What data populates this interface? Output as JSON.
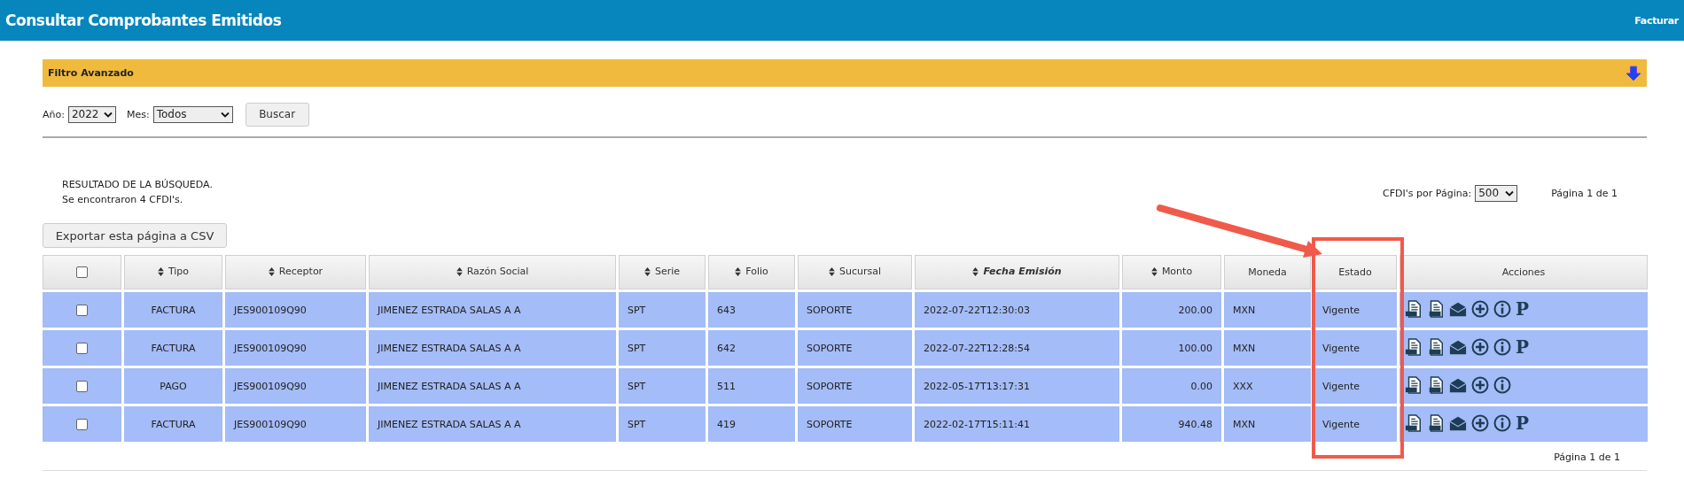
{
  "header": {
    "title": "Consultar Comprobantes Emitidos",
    "link": "Facturar"
  },
  "filter": {
    "title": "Filtro Avanzado",
    "expanded": false,
    "year_label": "Año:",
    "year": "2022",
    "month_label": "Mes:",
    "month": "Todos",
    "search_button": "Buscar"
  },
  "results": {
    "heading": "RESULTADO DE LA BÚSQUEDA.",
    "count": "Se encontraron 4 CFDI's.",
    "per_page_label": "CFDI's por Página:",
    "per_page": "500",
    "page_top": "Página 1 de 1",
    "export_button": "Exportar esta página a CSV",
    "page_bottom": "Página 1 de 1"
  },
  "table": {
    "select_all_checked": false,
    "columns": [
      {
        "label": "Tipo",
        "sortable": true,
        "sorted": false
      },
      {
        "label": "Receptor",
        "sortable": true,
        "sorted": false
      },
      {
        "label": "Razón Social",
        "sortable": true,
        "sorted": false
      },
      {
        "label": "Serie",
        "sortable": true,
        "sorted": false
      },
      {
        "label": "Folio",
        "sortable": true,
        "sorted": false
      },
      {
        "label": "Sucursal",
        "sortable": true,
        "sorted": false
      },
      {
        "label": "Fecha Emisión",
        "sortable": true,
        "sorted": true
      },
      {
        "label": "Monto",
        "sortable": true,
        "sorted": false
      },
      {
        "label": "Moneda",
        "sortable": false,
        "sorted": false
      },
      {
        "label": "Estado",
        "sortable": false,
        "sorted": false
      },
      {
        "label": "Acciones",
        "sortable": false,
        "sorted": false
      }
    ],
    "rows": [
      {
        "checked": false,
        "cells": [
          "FACTURA",
          "JES900109Q90",
          "JIMENEZ ESTRADA SALAS A A",
          "SPT",
          "643",
          "SOPORTE",
          "2022-07-22T12:30:03",
          "200.00",
          "MXN",
          "Vigente"
        ],
        "actions": [
          {
            "kind": "xml"
          },
          {
            "kind": "pdf"
          },
          {
            "kind": "mail"
          },
          {
            "kind": "add"
          },
          {
            "kind": "info"
          },
          {
            "kind": "letter",
            "label": "P"
          }
        ]
      },
      {
        "checked": false,
        "cells": [
          "FACTURA",
          "JES900109Q90",
          "JIMENEZ ESTRADA SALAS A A",
          "SPT",
          "642",
          "SOPORTE",
          "2022-07-22T12:28:54",
          "100.00",
          "MXN",
          "Vigente"
        ],
        "actions": [
          {
            "kind": "xml"
          },
          {
            "kind": "pdf"
          },
          {
            "kind": "mail"
          },
          {
            "kind": "add"
          },
          {
            "kind": "info"
          },
          {
            "kind": "letter",
            "label": "P"
          }
        ]
      },
      {
        "checked": false,
        "cells": [
          "PAGO",
          "JES900109Q90",
          "JIMENEZ ESTRADA SALAS A A",
          "SPT",
          "511",
          "SOPORTE",
          "2022-05-17T13:17:31",
          "0.00",
          "XXX",
          "Vigente"
        ],
        "actions": [
          {
            "kind": "xml"
          },
          {
            "kind": "pdf"
          },
          {
            "kind": "mail"
          },
          {
            "kind": "add"
          },
          {
            "kind": "info"
          }
        ]
      },
      {
        "checked": false,
        "cells": [
          "FACTURA",
          "JES900109Q90",
          "JIMENEZ ESTRADA SALAS A A",
          "SPT",
          "419",
          "SOPORTE",
          "2022-02-17T15:11:41",
          "940.48",
          "MXN",
          "Vigente"
        ],
        "actions": [
          {
            "kind": "xml"
          },
          {
            "kind": "pdf"
          },
          {
            "kind": "mail"
          },
          {
            "kind": "add"
          },
          {
            "kind": "info"
          },
          {
            "kind": "letter",
            "label": "P"
          }
        ]
      }
    ]
  }
}
